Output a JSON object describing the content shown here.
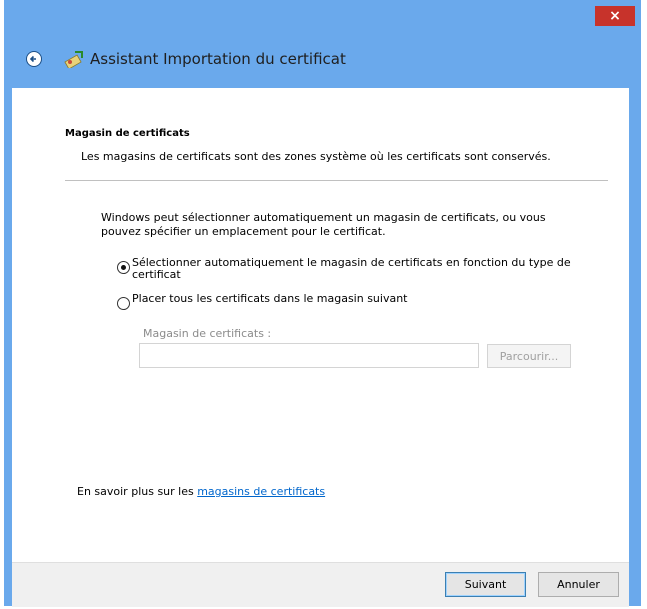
{
  "window": {
    "title": "Assistant Importation du certificat",
    "close_glyph": "×"
  },
  "section": {
    "title": "Magasin de certificats",
    "description": "Les magasins de certificats sont des zones système où les certificats sont conservés."
  },
  "body_text": "Windows peut sélectionner automatiquement un magasin de certificats, ou vous pouvez spécifier un emplacement pour le certificat.",
  "options": [
    {
      "label": "Sélectionner automatiquement le magasin de certificats en fonction du type de certificat",
      "checked": true
    },
    {
      "label": "Placer tous les certificats dans le magasin suivant",
      "checked": false
    }
  ],
  "store_field": {
    "label": "Magasin de certificats :",
    "value": "",
    "browse_label": "Parcourir..."
  },
  "learn_more": {
    "prefix": "En savoir plus sur les ",
    "link_text": "magasins de certificats"
  },
  "buttons": {
    "next": "Suivant",
    "cancel": "Annuler"
  },
  "icons": {
    "back": "back-arrow-icon",
    "wizard": "certificate-wizard-icon",
    "close": "close-icon"
  },
  "colors": {
    "frame": "#6aa9ec",
    "close": "#c7332b",
    "link": "#0066cc"
  }
}
